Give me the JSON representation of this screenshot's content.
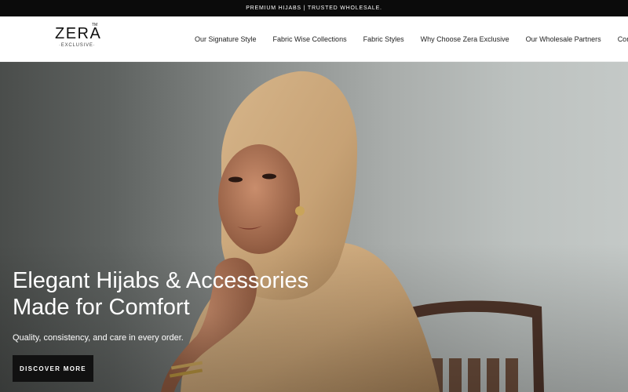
{
  "announcement": "PREMIUM HIJABS | TRUSTED WHOLESALE.",
  "brand": {
    "name": "ZERA",
    "tagline": "·EXCLUSIVE·",
    "trademark": "TM"
  },
  "nav": {
    "items": [
      {
        "label": "Our Signature Style"
      },
      {
        "label": "Fabric Wise Collections"
      },
      {
        "label": "Fabric Styles"
      },
      {
        "label": "Why Choose Zera Exclusive"
      },
      {
        "label": "Our Wholesale Partners"
      },
      {
        "label": "Contact"
      }
    ]
  },
  "hero": {
    "heading": "Elegant Hijabs & Accessories Made for Comfort",
    "subheading": "Quality, consistency, and care in every order.",
    "cta_label": "DISCOVER MORE"
  },
  "colors": {
    "topbar": "#0b0b0b",
    "cta": "#111111",
    "hijab": "#c9a77a"
  }
}
